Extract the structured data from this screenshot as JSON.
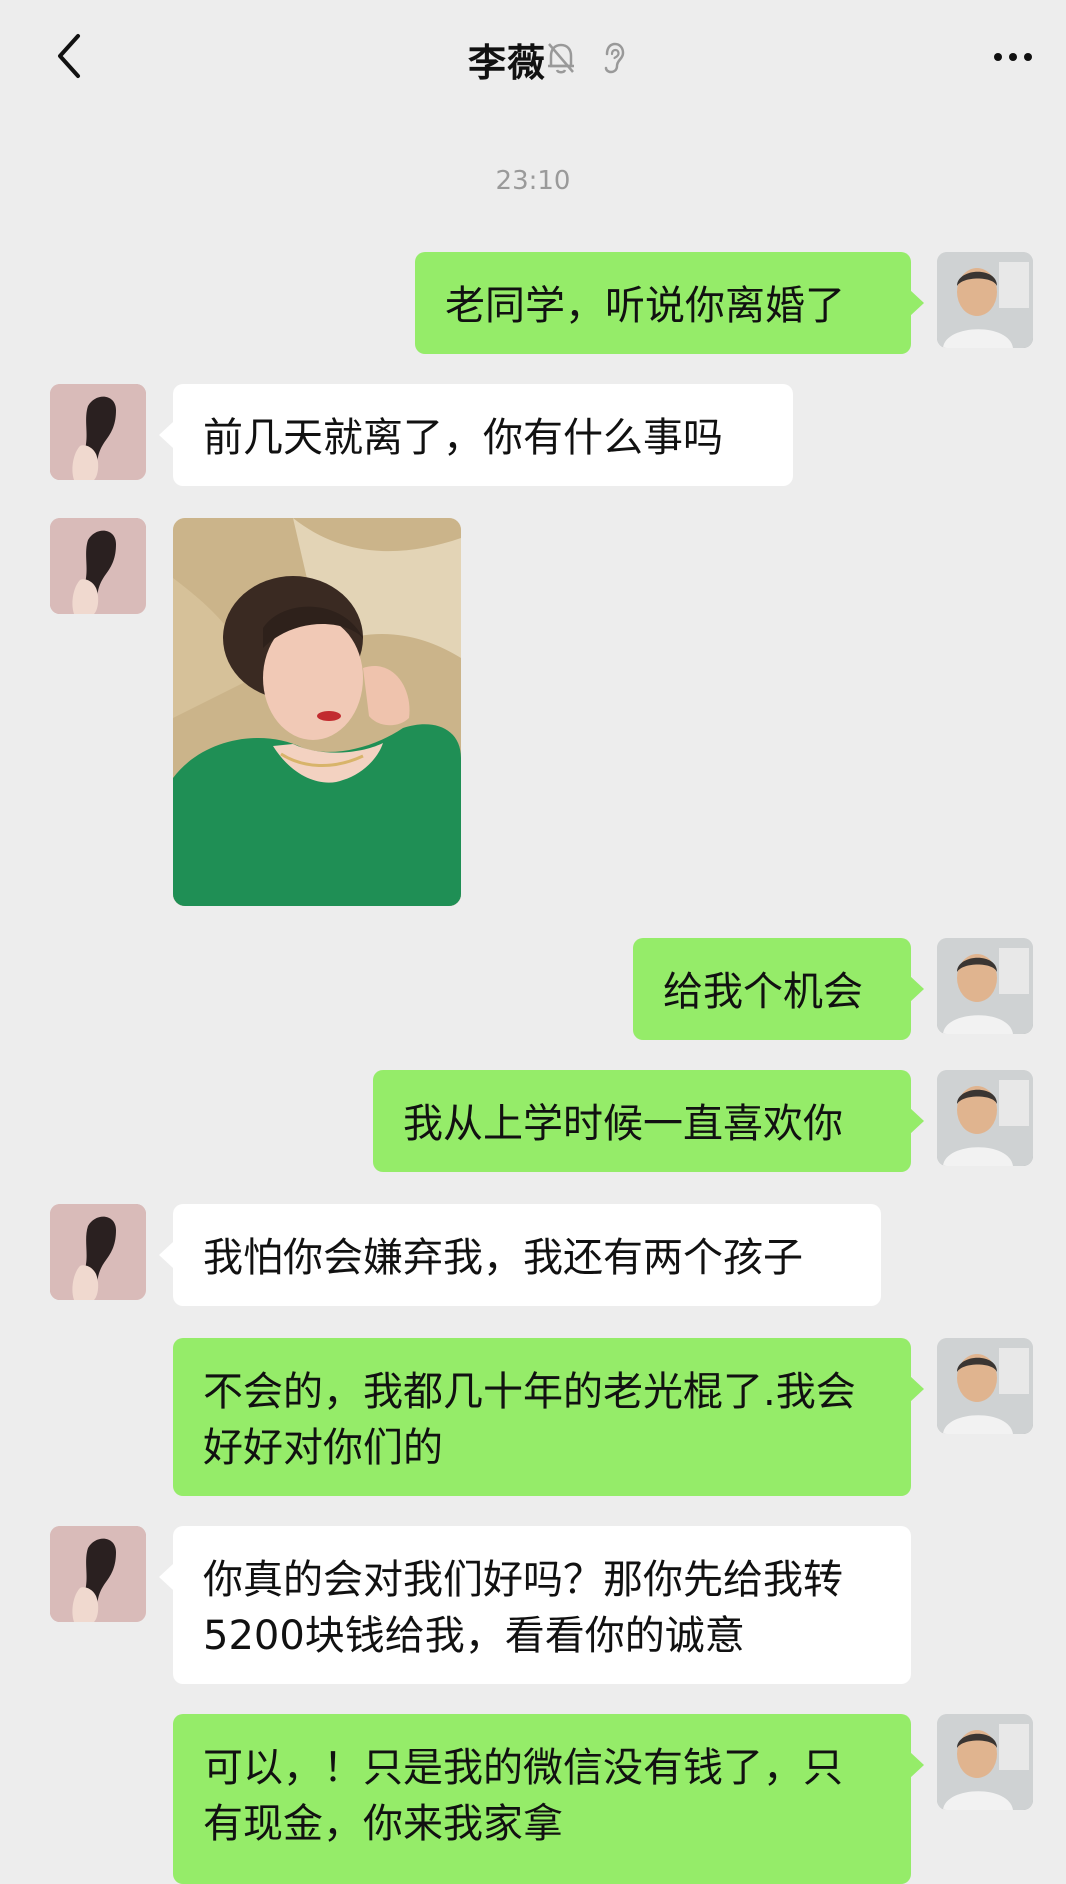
{
  "header": {
    "title": "李薇",
    "back_icon": "chevron-left-icon",
    "mute_icon": "bell-off-icon",
    "ear_icon": "ear-icon",
    "more_icon": "ellipsis-icon"
  },
  "timestamp": "23:10",
  "messages": [
    {
      "sender": "me",
      "text": "老同学，听说你离婚了"
    },
    {
      "sender": "her",
      "text": "前几天就离了，你有什么事吗"
    },
    {
      "sender": "her",
      "type": "image",
      "alt": ""
    },
    {
      "sender": "me",
      "text": "给我个机会"
    },
    {
      "sender": "me",
      "text": "我从上学时候一直喜欢你"
    },
    {
      "sender": "her",
      "text": "我怕你会嫌弃我，我还有两个孩子"
    },
    {
      "sender": "me",
      "text": "不会的，我都几十年的老光棍了.我会好好对你们的"
    },
    {
      "sender": "her",
      "text": "你真的会对我们好吗？那你先给我转5200块钱给我，看看你的诚意"
    },
    {
      "sender": "me",
      "text": "可以，！只是我的微信没有钱了，只有现金，你来我家拿"
    }
  ],
  "colors": {
    "background": "#ededed",
    "bubble_me": "#95ec69",
    "bubble_her": "#ffffff",
    "text": "#111111",
    "timestamp": "#9a9a9a"
  }
}
